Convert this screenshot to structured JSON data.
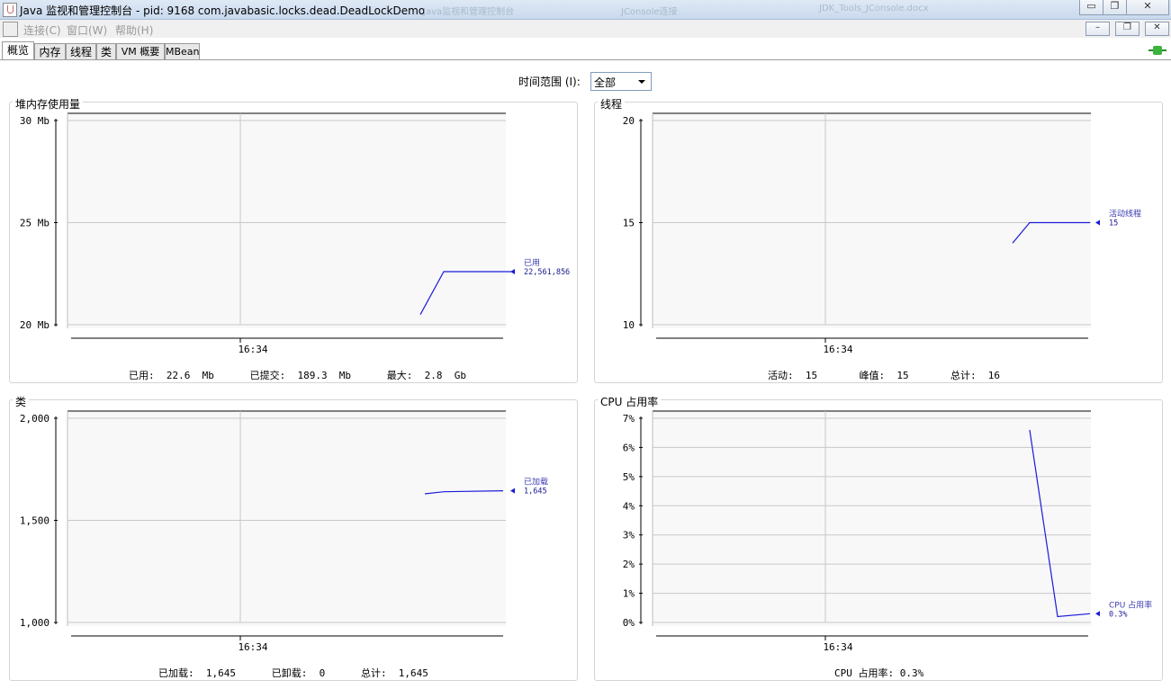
{
  "window": {
    "title": "Java 监视和管理控制台 - pid: 9168 com.javabasic.locks.dead.DeadLockDemo",
    "min": "▭",
    "restore": "❐",
    "close": "✕",
    "bg_tabs": [
      "Java监视和管理控制台",
      "JConsole连接",
      "JDK_Tools_JConsole.docx"
    ]
  },
  "menu": {
    "items": [
      "连接(C)",
      "窗口(W)",
      "帮助(H)"
    ],
    "inner_min": "–",
    "inner_restore": "❐",
    "inner_close": "✕"
  },
  "tabs": [
    "概览",
    "内存",
    "线程",
    "类",
    "VM 概要",
    "MBean"
  ],
  "time_range": {
    "label": "时间范围 (I):",
    "value": "全部"
  },
  "panels": {
    "heap": {
      "title": "堆内存使用量",
      "y_ticks": [
        "30 Mb",
        "25 Mb",
        "20 Mb"
      ],
      "x_tick": "16:34",
      "legend_name": "已用",
      "legend_value": "22,561,856",
      "summary": "已用:  22.6  Mb      已提交:  189.3  Mb      最大:  2.8  Gb"
    },
    "threads": {
      "title": "线程",
      "y_ticks": [
        "20",
        "15",
        "10"
      ],
      "x_tick": "16:34",
      "legend_name": "活动线程",
      "legend_value": "15",
      "summary": "活动:  15       峰值:  15       总计:  16"
    },
    "classes": {
      "title": "类",
      "y_ticks": [
        "2,000",
        "1,500",
        "1,000"
      ],
      "x_tick": "16:34",
      "legend_name": "已加载",
      "legend_value": "1,645",
      "summary": "已加载:  1,645      已卸载:  0      总计:  1,645"
    },
    "cpu": {
      "title": "CPU 占用率",
      "y_ticks": [
        "7%",
        "6%",
        "5%",
        "4%",
        "3%",
        "2%",
        "1%",
        "0%"
      ],
      "x_tick": "16:34",
      "legend_name": "CPU 占用率",
      "legend_value": "0.3%",
      "summary": "CPU 占用率: 0.3%"
    }
  },
  "colors": {
    "line": "#1a1adb",
    "grid": "#c8c8c8",
    "plot_bg": "#f8f8f8",
    "frame": "#808080"
  },
  "chart_data": [
    {
      "type": "line",
      "title": "堆内存使用量",
      "ylabel": "Mb",
      "ylim": [
        20,
        30
      ],
      "x": [
        0,
        1,
        2
      ],
      "series": [
        {
          "name": "已用",
          "values": [
            20.5,
            22.6,
            22.6
          ]
        }
      ]
    },
    {
      "type": "line",
      "title": "线程",
      "ylim": [
        10,
        20
      ],
      "x": [
        0,
        1,
        2
      ],
      "series": [
        {
          "name": "活动线程",
          "values": [
            14,
            15,
            15
          ]
        }
      ]
    },
    {
      "type": "line",
      "title": "类",
      "ylim": [
        1000,
        2000
      ],
      "x": [
        0,
        1,
        2
      ],
      "series": [
        {
          "name": "已加载",
          "values": [
            1630,
            1640,
            1645
          ]
        }
      ]
    },
    {
      "type": "line",
      "title": "CPU 占用率",
      "ylabel": "%",
      "ylim": [
        0,
        7
      ],
      "x": [
        0,
        1,
        2
      ],
      "series": [
        {
          "name": "CPU 占用率",
          "values": [
            6.6,
            0.2,
            0.3
          ]
        }
      ]
    }
  ]
}
